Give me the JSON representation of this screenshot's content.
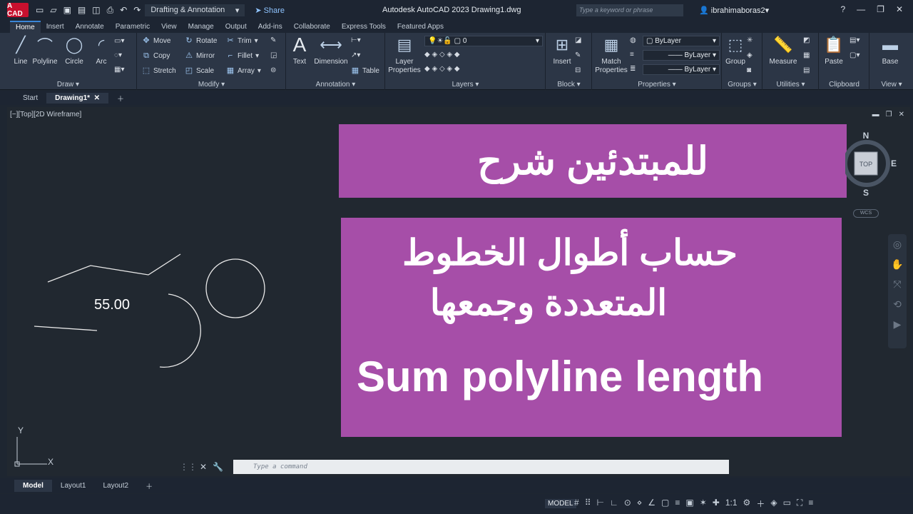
{
  "app": {
    "logo": "A CAD",
    "workspace": "Drafting & Annotation",
    "share": "Share",
    "title": "Autodesk AutoCAD 2023    Drawing1.dwg",
    "search_placeholder": "Type a keyword or phrase",
    "user": "ibrahimaboras2"
  },
  "ribbon_tabs": [
    "Home",
    "Insert",
    "Annotate",
    "Parametric",
    "View",
    "Manage",
    "Output",
    "Add-ins",
    "Collaborate",
    "Express Tools",
    "Featured Apps"
  ],
  "draw": {
    "label": "Draw",
    "line": "Line",
    "polyline": "Polyline",
    "circle": "Circle",
    "arc": "Arc"
  },
  "modify": {
    "label": "Modify",
    "move": "Move",
    "rotate": "Rotate",
    "trim": "Trim",
    "copy": "Copy",
    "mirror": "Mirror",
    "fillet": "Fillet",
    "stretch": "Stretch",
    "scale": "Scale",
    "array": "Array"
  },
  "annotation": {
    "label": "Annotation",
    "text": "Text",
    "dimension": "Dimension",
    "table": "Table"
  },
  "layers": {
    "label": "Layers",
    "layer_properties": "Layer Properties",
    "current_layer": "0"
  },
  "block": {
    "label": "Block",
    "insert": "Insert"
  },
  "properties": {
    "label": "Properties",
    "match": "Match Properties",
    "color": "ByLayer",
    "linetype": "ByLayer",
    "lineweight": "ByLayer"
  },
  "groups": {
    "label": "Groups",
    "group": "Group"
  },
  "utilities": {
    "label": "Utilities",
    "measure": "Measure"
  },
  "clipboard": {
    "label": "Clipboard",
    "paste": "Paste"
  },
  "view_panel": {
    "label": "View",
    "base": "Base"
  },
  "doc_tabs": [
    "Start",
    "Drawing1*"
  ],
  "viewport": {
    "label": "[−][Top][2D Wireframe]",
    "dimension_text": "55.00",
    "compass": {
      "n": "N",
      "e": "E",
      "s": "S",
      "top": "TOP",
      "wcs": "WCS"
    },
    "ucs": {
      "x": "X",
      "y": "Y"
    }
  },
  "overlay": {
    "line1": "للمبتدئين  شرح",
    "line2": "حساب أطوال الخطوط",
    "line3": "المتعددة وجمعها",
    "line4": "Sum polyline length"
  },
  "command": {
    "placeholder": "Type a command"
  },
  "layout_tabs": [
    "Model",
    "Layout1",
    "Layout2"
  ],
  "status": {
    "model": "MODEL",
    "scale": "1:1"
  }
}
